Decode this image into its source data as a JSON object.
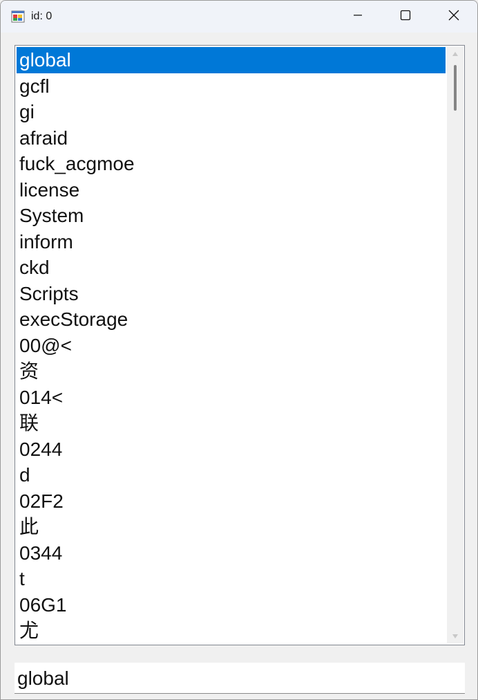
{
  "window": {
    "title": "id: 0",
    "icon": "windows-app-icon",
    "controls": [
      "minimize-icon",
      "maximize-icon",
      "close-icon"
    ]
  },
  "listbox": {
    "selected_index": 0,
    "selection_color": "#0078d7",
    "items": [
      "global",
      "gcfl",
      "gi",
      "afraid",
      "fuck_acgmoe",
      "license",
      "System",
      "inform",
      "ckd",
      "Scripts",
      "execStorage",
      "00@<",
      "资",
      "014<",
      "联",
      "0244",
      "d",
      "02F2",
      "此",
      "0344",
      "t",
      "06G1",
      "尤"
    ]
  },
  "input": {
    "value": "global"
  }
}
